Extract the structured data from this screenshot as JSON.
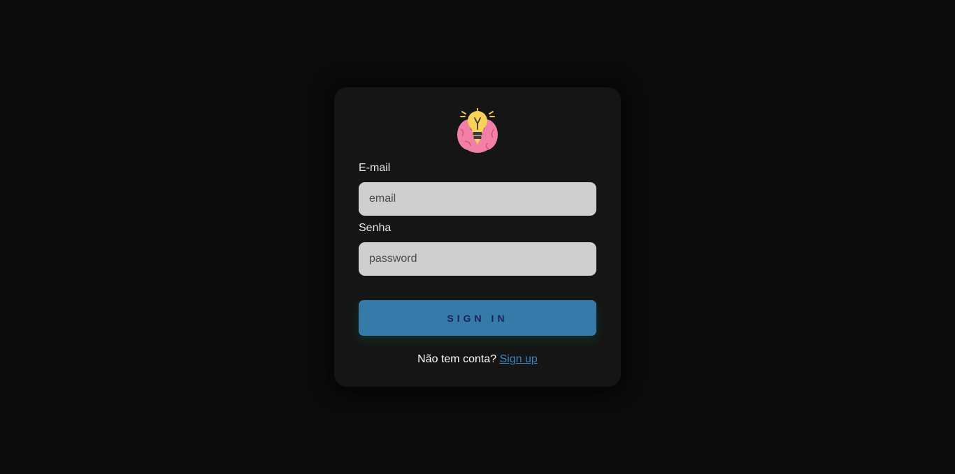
{
  "login": {
    "logo_icon": "brain-lightbulb-icon",
    "email_label": "E-mail",
    "email_placeholder": "email",
    "email_value": "",
    "password_label": "Senha",
    "password_placeholder": "password",
    "password_value": "",
    "signin_label": "SIGN IN",
    "signup_prompt": "Não tem conta?",
    "signup_link": "Sign up"
  },
  "colors": {
    "background": "#0b0b0b",
    "card": "#151515",
    "input": "#cfcfcf",
    "button": "#357aa8",
    "button_text": "#1b1f5c",
    "link": "#3a84c4"
  }
}
